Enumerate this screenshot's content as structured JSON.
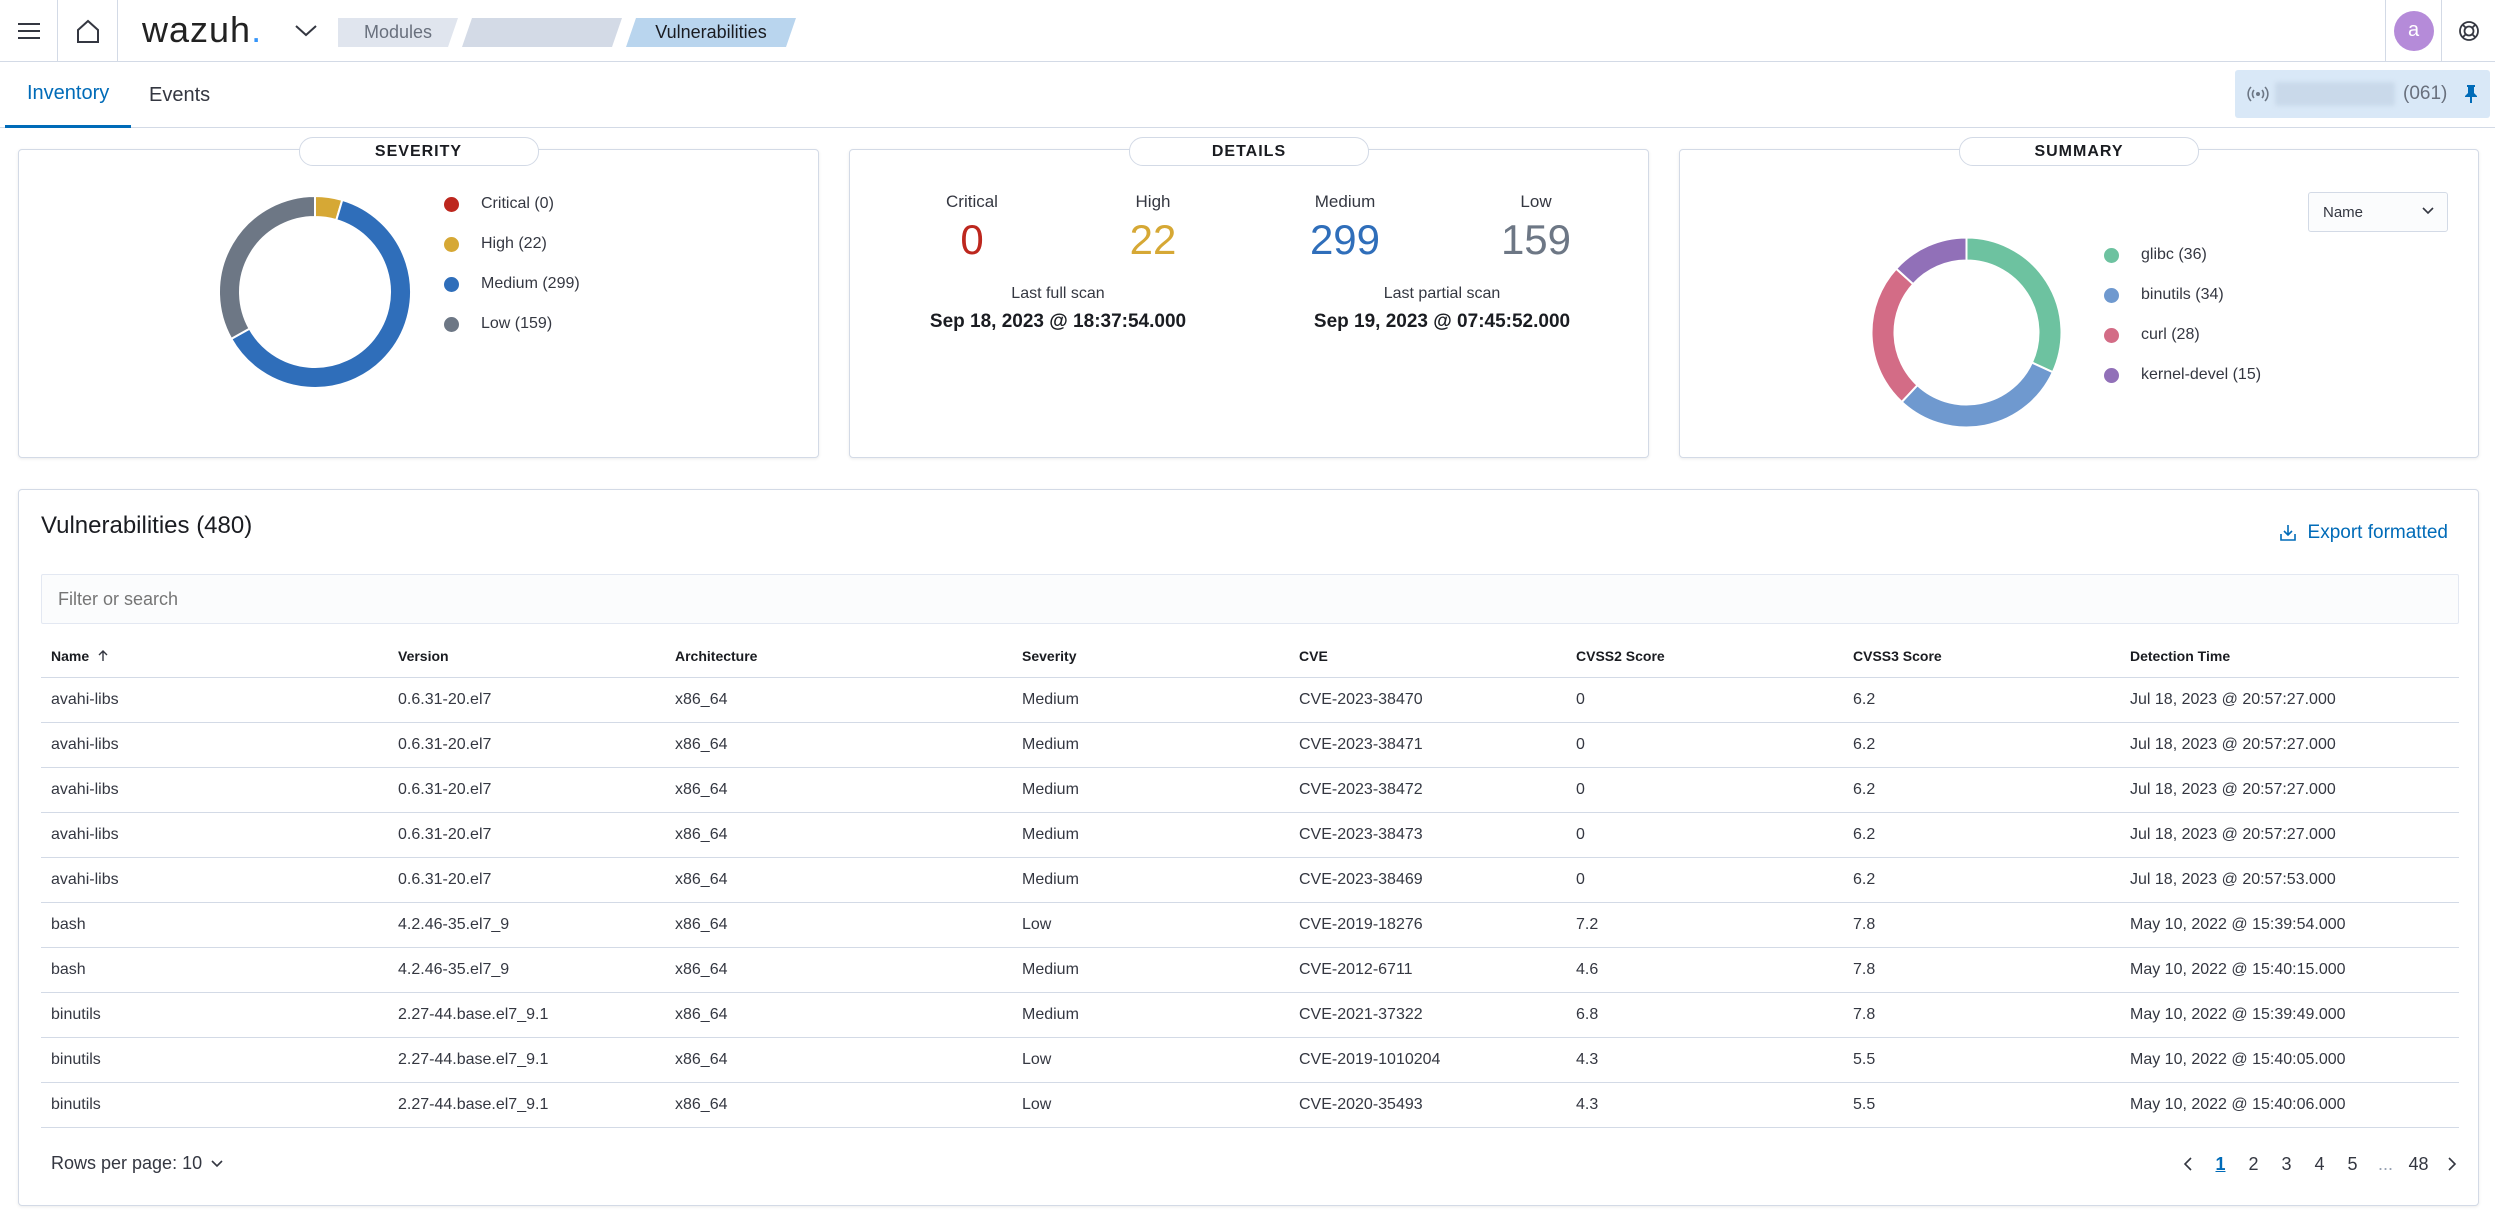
{
  "header": {
    "logo_text": "wazuh",
    "logo_dot": ".",
    "breadcrumbs": [
      "Modules",
      "",
      "Vulnerabilities"
    ],
    "avatar_initial": "a"
  },
  "tabs": [
    {
      "label": "Inventory",
      "active": true
    },
    {
      "label": "Events",
      "active": false
    }
  ],
  "agent": {
    "count": "(061)"
  },
  "severity_panel": {
    "title": "SEVERITY",
    "legend": [
      {
        "label": "Critical (0)",
        "color": "#bd271e",
        "value": 0
      },
      {
        "label": "High (22)",
        "color": "#d6a835",
        "value": 22
      },
      {
        "label": "Medium (299)",
        "color": "#2f6eba",
        "value": 299
      },
      {
        "label": "Low (159)",
        "color": "#6d7785",
        "value": 159
      }
    ]
  },
  "details_panel": {
    "title": "DETAILS",
    "stats": [
      {
        "label": "Critical",
        "value": "0",
        "color": "#bd271e"
      },
      {
        "label": "High",
        "value": "22",
        "color": "#d6a835"
      },
      {
        "label": "Medium",
        "value": "299",
        "color": "#2f6eba"
      },
      {
        "label": "Low",
        "value": "159",
        "color": "#6d7785"
      }
    ],
    "last_full_scan_label": "Last full scan",
    "last_full_scan": "Sep 18, 2023 @ 18:37:54.000",
    "last_partial_scan_label": "Last partial scan",
    "last_partial_scan": "Sep 19, 2023 @ 07:45:52.000"
  },
  "summary_panel": {
    "title": "SUMMARY",
    "select_value": "Name",
    "legend": [
      {
        "label": "glibc (36)",
        "color": "#6dc2a0",
        "value": 36
      },
      {
        "label": "binutils (34)",
        "color": "#6f99cf",
        "value": 34
      },
      {
        "label": "curl (28)",
        "color": "#d36c86",
        "value": 28
      },
      {
        "label": "kernel-devel (15)",
        "color": "#9170b8",
        "value": 15
      }
    ]
  },
  "vulnerabilities": {
    "title": "Vulnerabilities (480)",
    "export_label": "Export formatted",
    "search_placeholder": "Filter or search",
    "columns": [
      "Name",
      "Version",
      "Architecture",
      "Severity",
      "CVE",
      "CVSS2 Score",
      "CVSS3 Score",
      "Detection Time"
    ],
    "rows": [
      [
        "avahi-libs",
        "0.6.31-20.el7",
        "x86_64",
        "Medium",
        "CVE-2023-38470",
        "0",
        "6.2",
        "Jul 18, 2023 @ 20:57:27.000"
      ],
      [
        "avahi-libs",
        "0.6.31-20.el7",
        "x86_64",
        "Medium",
        "CVE-2023-38471",
        "0",
        "6.2",
        "Jul 18, 2023 @ 20:57:27.000"
      ],
      [
        "avahi-libs",
        "0.6.31-20.el7",
        "x86_64",
        "Medium",
        "CVE-2023-38472",
        "0",
        "6.2",
        "Jul 18, 2023 @ 20:57:27.000"
      ],
      [
        "avahi-libs",
        "0.6.31-20.el7",
        "x86_64",
        "Medium",
        "CVE-2023-38473",
        "0",
        "6.2",
        "Jul 18, 2023 @ 20:57:27.000"
      ],
      [
        "avahi-libs",
        "0.6.31-20.el7",
        "x86_64",
        "Medium",
        "CVE-2023-38469",
        "0",
        "6.2",
        "Jul 18, 2023 @ 20:57:53.000"
      ],
      [
        "bash",
        "4.2.46-35.el7_9",
        "x86_64",
        "Low",
        "CVE-2019-18276",
        "7.2",
        "7.8",
        "May 10, 2022 @ 15:39:54.000"
      ],
      [
        "bash",
        "4.2.46-35.el7_9",
        "x86_64",
        "Medium",
        "CVE-2012-6711",
        "4.6",
        "7.8",
        "May 10, 2022 @ 15:40:15.000"
      ],
      [
        "binutils",
        "2.27-44.base.el7_9.1",
        "x86_64",
        "Medium",
        "CVE-2021-37322",
        "6.8",
        "7.8",
        "May 10, 2022 @ 15:39:49.000"
      ],
      [
        "binutils",
        "2.27-44.base.el7_9.1",
        "x86_64",
        "Low",
        "CVE-2019-1010204",
        "4.3",
        "5.5",
        "May 10, 2022 @ 15:40:05.000"
      ],
      [
        "binutils",
        "2.27-44.base.el7_9.1",
        "x86_64",
        "Low",
        "CVE-2020-35493",
        "4.3",
        "5.5",
        "May 10, 2022 @ 15:40:06.000"
      ]
    ],
    "rows_per_page_label": "Rows per page: 10",
    "pages": [
      "1",
      "2",
      "3",
      "4",
      "5",
      "...",
      "48"
    ],
    "current_page": "1"
  }
}
